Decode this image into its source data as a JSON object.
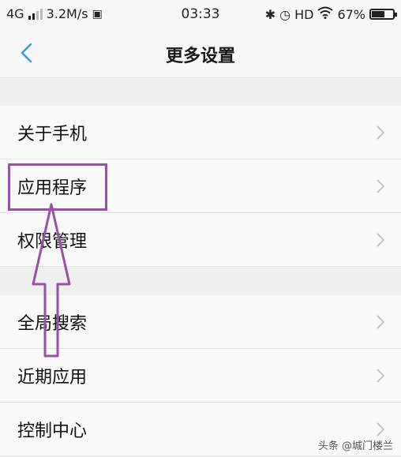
{
  "status_bar": {
    "network": "4G",
    "speed": "3.2M/s",
    "time": "03:33",
    "hd": "HD",
    "battery": "67%",
    "battery_level": 0.67
  },
  "nav": {
    "title": "更多设置"
  },
  "sections": [
    {
      "items": [
        {
          "label": "关于手机"
        },
        {
          "label": "应用程序"
        },
        {
          "label": "权限管理"
        }
      ]
    },
    {
      "items": [
        {
          "label": "全局搜索"
        },
        {
          "label": "近期应用"
        },
        {
          "label": "控制中心"
        }
      ]
    }
  ],
  "watermark": "头条 @城门楼兰",
  "colors": {
    "accent_blue": "#3a9ad9",
    "annotation_purple": "#9b4fa8",
    "chevron": "#c4c4c4"
  }
}
